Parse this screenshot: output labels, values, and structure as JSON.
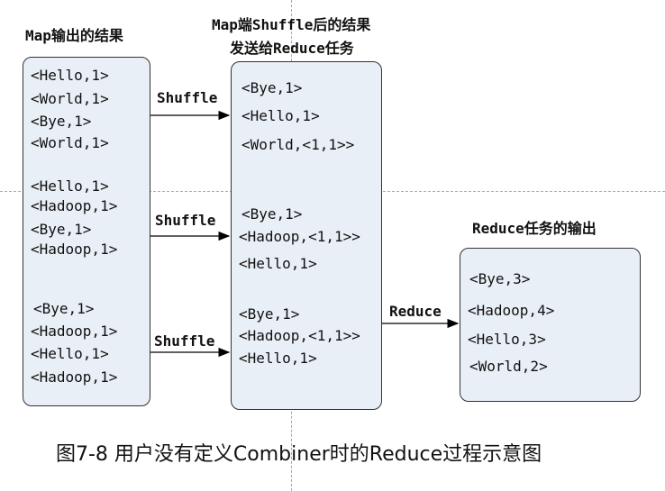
{
  "titles": {
    "map_output": "Map输出的结果",
    "shuffle_result_line1": "Map端Shuffle后的结果",
    "shuffle_result_line2": "发送给Reduce任务",
    "reduce_output": "Reduce任务的输出"
  },
  "map_box": {
    "group1": [
      "<Hello,1>",
      "<World,1>",
      "<Bye,1>",
      "<World,1>"
    ],
    "group2": [
      "<Hello,1>",
      "<Hadoop,1>",
      "<Bye,1>",
      "<Hadoop,1>"
    ],
    "group3": [
      "<Bye,1>",
      "<Hadoop,1>",
      "<Hello,1>",
      "<Hadoop,1>"
    ]
  },
  "shuffle_box": {
    "group1": [
      "<Bye,1>",
      "<Hello,1>",
      "<World,<1,1>>"
    ],
    "group2": [
      "<Bye,1>",
      "<Hadoop,<1,1>>",
      "<Hello,1>"
    ],
    "group3": [
      "<Bye,1>",
      "<Hadoop,<1,1>>",
      "<Hello,1>"
    ]
  },
  "reduce_box": {
    "items": [
      "<Bye,3>",
      "<Hadoop,4>",
      "<Hello,3>",
      "<World,2>"
    ]
  },
  "edges": {
    "shuffle_1": "Shuffle",
    "shuffle_2": "Shuffle",
    "shuffle_3": "Shuffle",
    "reduce": "Reduce"
  },
  "caption": "图7-8 用户没有定义Combiner时的Reduce过程示意图",
  "colors": {
    "box_fill": "#e9eff6",
    "box_border": "#333333",
    "arrow": "#000000"
  }
}
